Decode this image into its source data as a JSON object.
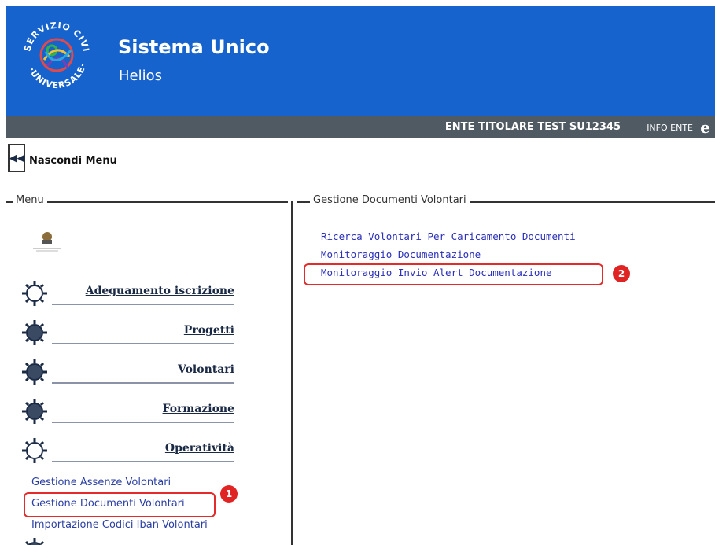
{
  "header": {
    "logo_text": "SERVIZIO CIVILE UNIVERSALE",
    "title": "Sistema Unico",
    "subtitle": "Helios"
  },
  "entity_bar": {
    "entity": "ENTE TITOLARE TEST  SU12345",
    "info": "INFO ENTE",
    "icon": "e"
  },
  "hide_menu": {
    "icon": "◀◀",
    "label": "Nascondi Menu"
  },
  "menu": {
    "legend": "Menu",
    "items": [
      {
        "label": "Adeguamento iscrizione",
        "icon": "gear-outline-icon"
      },
      {
        "label": "Progetti",
        "icon": "gear-filled-icon"
      },
      {
        "label": "Volontari",
        "icon": "gear-filled-icon"
      },
      {
        "label": "Formazione",
        "icon": "gear-filled-icon"
      },
      {
        "label": "Operatività",
        "icon": "gear-outline-icon"
      }
    ],
    "sub_items": [
      {
        "label": "Gestione Assenze Volontari"
      },
      {
        "label": "Gestione Documenti Volontari"
      },
      {
        "label": "Importazione Codici Iban Volontari"
      }
    ]
  },
  "content": {
    "legend": "Gestione Documenti Volontari",
    "links": [
      {
        "label": "Ricerca Volontari Per Caricamento Documenti"
      },
      {
        "label": "Monitoraggio Documentazione"
      },
      {
        "label": "Monitoraggio Invio Alert Documentazione"
      }
    ]
  },
  "annotations": {
    "badge1": "1",
    "badge2": "2",
    "color": "#e02424"
  }
}
